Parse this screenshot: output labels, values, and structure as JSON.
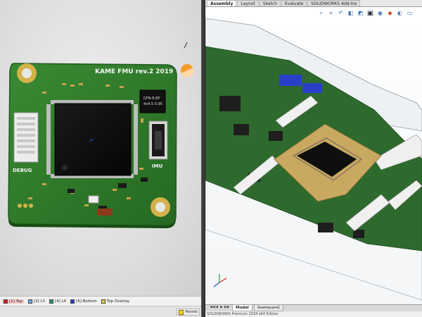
{
  "left_viewer": {
    "board_title": "KAME FMU rev.2 2019",
    "chip_label_line1": "DFN-8-EP",
    "chip_label_line2": "4x4.5 0.95",
    "imu_label": "IMU",
    "debug_label": "DEBUG",
    "board_color": "#2f7a2a",
    "pad_gold": "#d4b24a",
    "layers": [
      {
        "label": "[1] Top",
        "color": "#e02020",
        "active": true
      },
      {
        "label": "[3] L3",
        "color": "#6aa8ff",
        "active": false
      },
      {
        "label": "[4] L4",
        "color": "#2a9a6a",
        "active": false
      },
      {
        "label": "[6] Bottom",
        "color": "#2636c8",
        "active": false
      },
      {
        "label": "Top Overlay",
        "color": "#f2d21e",
        "active": false
      }
    ],
    "panels_label": "Panels"
  },
  "solidworks": {
    "tabs": [
      {
        "label": "Assembly",
        "active": true
      },
      {
        "label": "Layout",
        "active": false
      },
      {
        "label": "Sketch",
        "active": false
      },
      {
        "label": "Evaluate",
        "active": false
      },
      {
        "label": "SOLIDWORKS Add-Ins",
        "active": false
      }
    ],
    "toolbar_icons": [
      "zoom-to-fit-icon",
      "zoom-area-icon",
      "previous-view-icon",
      "section-view-icon",
      "view-orientation-icon",
      "display-style-icon",
      "hide-show-icon",
      "appearance-icon",
      "scene-icon",
      "monitor-icon"
    ],
    "bottom_tabs": [
      {
        "label": "Model",
        "active": true
      },
      {
        "label": "Анимация1",
        "active": false
      }
    ],
    "status_text": "SOLIDWORKS Premium 2018 x64 Edition"
  }
}
